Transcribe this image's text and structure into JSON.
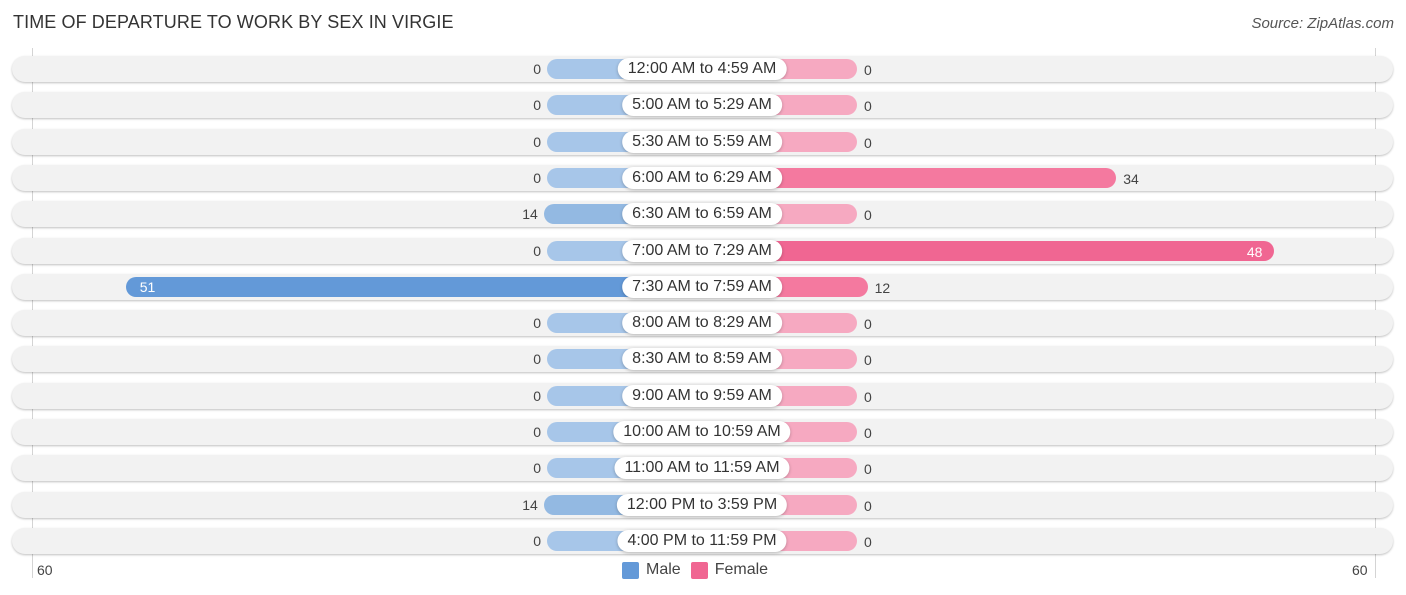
{
  "header": {
    "title": "TIME OF DEPARTURE TO WORK BY SEX IN VIRGIE",
    "source": "Source: ZipAtlas.com"
  },
  "colors": {
    "male": "#6399d8",
    "male_light": "#a7c6e9",
    "female": "#f06692",
    "female_light": "#f6a9c1",
    "row_bg": "#f2f2f2"
  },
  "chart_data": {
    "type": "bar",
    "orientation": "horizontal-diverging",
    "title": "TIME OF DEPARTURE TO WORK BY SEX IN VIRGIE",
    "categories": [
      "12:00 AM to 4:59 AM",
      "5:00 AM to 5:29 AM",
      "5:30 AM to 5:59 AM",
      "6:00 AM to 6:29 AM",
      "6:30 AM to 6:59 AM",
      "7:00 AM to 7:29 AM",
      "7:30 AM to 7:59 AM",
      "8:00 AM to 8:29 AM",
      "8:30 AM to 8:59 AM",
      "9:00 AM to 9:59 AM",
      "10:00 AM to 10:59 AM",
      "11:00 AM to 11:59 AM",
      "12:00 PM to 3:59 PM",
      "4:00 PM to 11:59 PM"
    ],
    "series": [
      {
        "name": "Male",
        "values": [
          0,
          0,
          0,
          0,
          14,
          0,
          51,
          0,
          0,
          0,
          0,
          0,
          14,
          0
        ]
      },
      {
        "name": "Female",
        "values": [
          0,
          0,
          0,
          34,
          0,
          48,
          12,
          0,
          0,
          0,
          0,
          0,
          0,
          0
        ]
      }
    ],
    "xlim": [
      -60,
      60
    ],
    "axis_tick_labels": {
      "left": "60",
      "right": "60"
    },
    "legend": {
      "position": "bottom-center",
      "entries": [
        "Male",
        "Female"
      ]
    },
    "grid": false
  }
}
